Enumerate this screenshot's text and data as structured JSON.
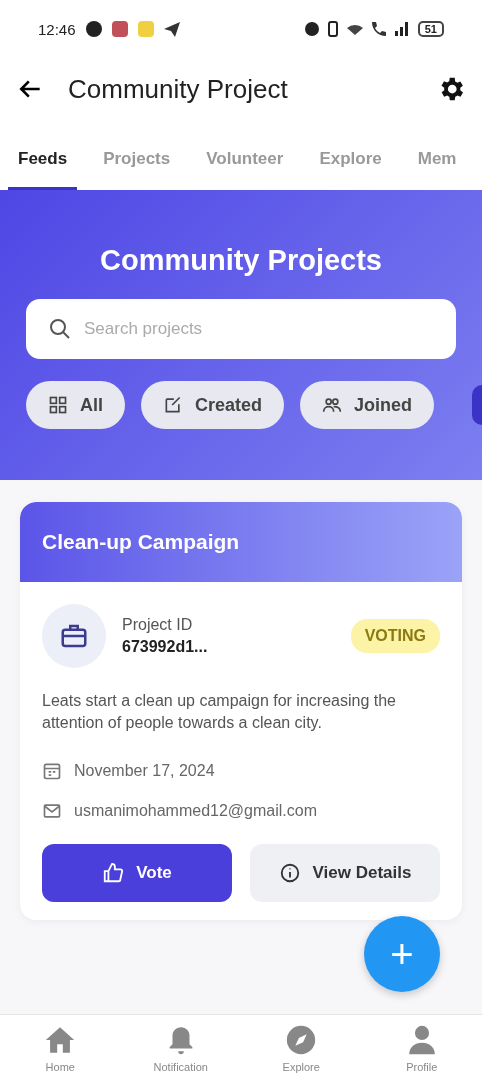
{
  "status_bar": {
    "time": "12:46",
    "battery": "51"
  },
  "app_bar": {
    "title": "Community Project"
  },
  "tabs": [
    {
      "label": "Feeds",
      "selected": true
    },
    {
      "label": "Projects",
      "selected": false
    },
    {
      "label": "Volunteer",
      "selected": false
    },
    {
      "label": "Explore",
      "selected": false
    },
    {
      "label": "Mem",
      "selected": false
    }
  ],
  "hero": {
    "title": "Community Projects",
    "search": {
      "placeholder": "Search projects"
    },
    "filters": [
      {
        "label": "All",
        "kind": "grid",
        "selected": false
      },
      {
        "label": "Created",
        "kind": "edit",
        "selected": false
      },
      {
        "label": "Joined",
        "kind": "people",
        "selected": false
      }
    ]
  },
  "projects": [
    {
      "title": "Clean-up Campaign",
      "id_label": "Project ID",
      "id": "673992d1...",
      "status": "VOTING",
      "description": "Leats start a clean up campaign for increasing the attention of people towards a clean city.",
      "date": "November 17, 2024",
      "email": "usmanimohammed12@gmail.com",
      "buttons": [
        {
          "label": "Vote",
          "kind": "primary"
        },
        {
          "label": "View Details",
          "kind": "secondary"
        }
      ]
    }
  ],
  "fab": {
    "label": "+"
  },
  "bottom_nav": [
    {
      "label": "Home",
      "kind": "home",
      "selected": false
    },
    {
      "label": "Notification",
      "kind": "bell",
      "selected": false
    },
    {
      "label": "Explore",
      "kind": "compass",
      "selected": false
    },
    {
      "label": "Profile",
      "kind": "person",
      "selected": false
    }
  ]
}
